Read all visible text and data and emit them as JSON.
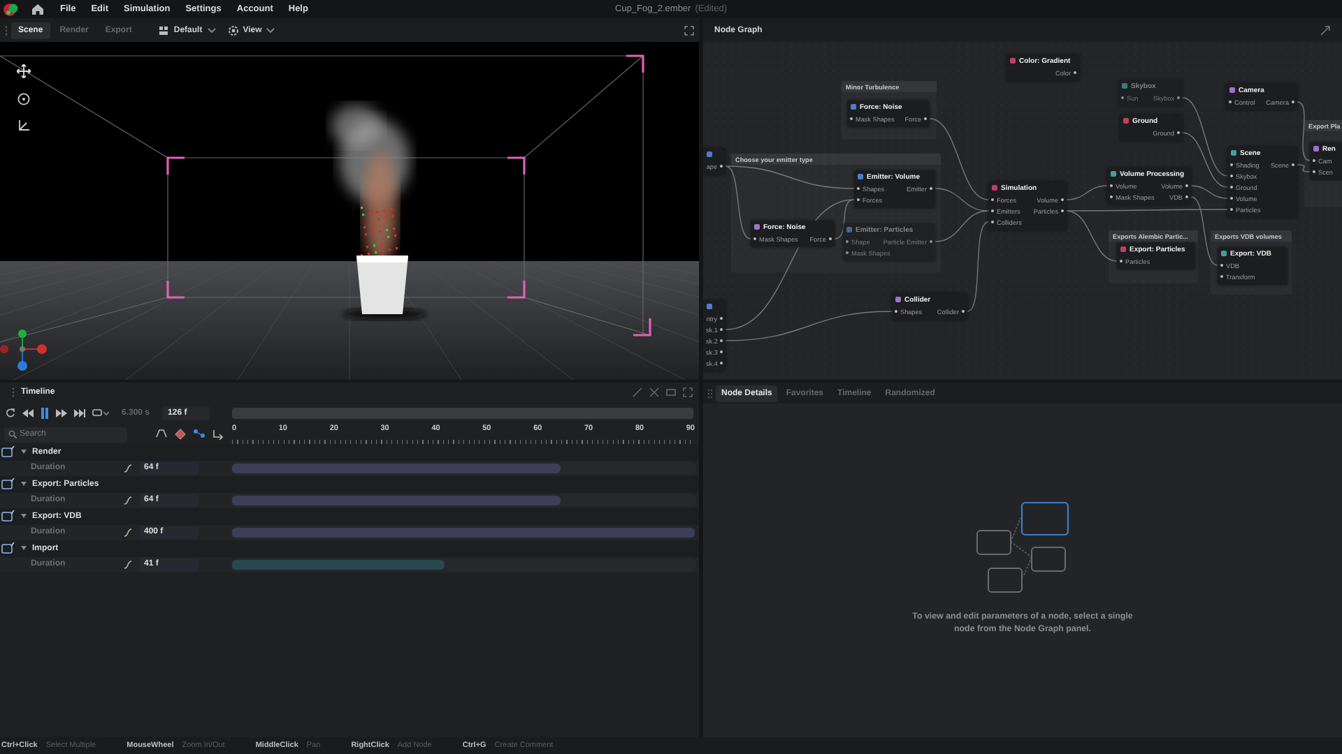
{
  "app": {
    "menu": [
      "File",
      "Edit",
      "Simulation",
      "Settings",
      "Account",
      "Help"
    ],
    "title": "Cup_Fog_2.ember",
    "status": "(Edited)"
  },
  "viewport_toolbar": {
    "tabs": [
      {
        "label": "Scene",
        "selected": true
      },
      {
        "label": "Render",
        "selected": false
      },
      {
        "label": "Export",
        "selected": false
      }
    ],
    "layout": "Default",
    "view": "View"
  },
  "node_graph": {
    "title": "Node Graph",
    "groups": [
      {
        "title": "Minor Turbulence"
      },
      {
        "title": "Export Pla"
      },
      {
        "title": "Choose your emitter type"
      },
      {
        "title": "Exports Alembic Partic..."
      },
      {
        "title": "Exports VDB volumes"
      }
    ],
    "nodes": [
      {
        "outputs": [
          "ape"
        ],
        "disabled": false
      },
      {
        "title": "Color: Gradient",
        "outputs": [
          "Color"
        ],
        "disabled": false
      },
      {
        "title": "Skybox",
        "inputs": [
          "Sun"
        ],
        "outputs": [
          "Skybox"
        ],
        "disabled": true
      },
      {
        "title": "Camera",
        "inputs": [
          "Control"
        ],
        "outputs": [
          "Camera"
        ],
        "disabled": false
      },
      {
        "title": "Force: Noise",
        "inputs": [
          "Mask Shapes"
        ],
        "outputs": [
          "Force"
        ],
        "disabled": false
      },
      {
        "title": "Ground",
        "outputs": [
          "Ground"
        ],
        "disabled": false
      },
      {
        "title": "Scene",
        "inputs": [
          "Shading",
          "Skybox",
          "Ground",
          "Volume",
          "Particles"
        ],
        "outputs": [
          "Scene"
        ],
        "disabled": false
      },
      {
        "title": "Ren",
        "inputs": [
          "Cam",
          "Scen"
        ],
        "disabled": false
      },
      {
        "title": "Emitter: Volume",
        "inputs": [
          "Shapes",
          "Forces"
        ],
        "outputs": [
          "Emitter"
        ],
        "disabled": false
      },
      {
        "title": "Simulation",
        "inputs": [
          "Forces",
          "Emitters",
          "Colliders"
        ],
        "outputs": [
          "Volume",
          "Particles"
        ],
        "disabled": false
      },
      {
        "title": "Volume Processing",
        "inputs": [
          "Volume",
          "Mask Shapes"
        ],
        "outputs": [
          "Volume",
          "VDB"
        ],
        "disabled": false
      },
      {
        "title": "Force: Noise",
        "inputs": [
          "Mask Shapes"
        ],
        "outputs": [
          "Force"
        ],
        "disabled": false
      },
      {
        "title": "Emitter: Particles",
        "inputs": [
          "Shape",
          "Mask Shapes"
        ],
        "outputs": [
          "Particle Emitter"
        ],
        "disabled": true
      },
      {
        "title": "Export: Particles",
        "inputs": [
          "Particles"
        ],
        "disabled": false
      },
      {
        "title": "Export: VDB",
        "inputs": [
          "VDB",
          "Transform"
        ],
        "disabled": false
      },
      {
        "title": "Collider",
        "inputs": [
          "Shapes"
        ],
        "outputs": [
          "Collider"
        ],
        "disabled": false
      },
      {
        "outputs": [
          "ntry",
          "sk.1",
          "sk.2",
          "sk.3",
          "sk.4"
        ],
        "disabled": false
      }
    ]
  },
  "timeline": {
    "title": "Timeline",
    "playing": true,
    "time": "6.300 s",
    "frame": "126 f",
    "search": {
      "placeholder": "Search"
    },
    "ruler": [
      "0",
      "10",
      "20",
      "30",
      "40",
      "50",
      "60",
      "70",
      "80",
      "90"
    ],
    "tracks": [
      {
        "name": "Render",
        "expanded": true,
        "param": "Duration",
        "value": "64 f",
        "level": 0.71,
        "color": "#3c3f55"
      },
      {
        "name": "Export: Particles",
        "expanded": true,
        "param": "Duration",
        "value": "64 f",
        "level": 0.71,
        "color": "#3c3f55"
      },
      {
        "name": "Export: VDB",
        "expanded": true,
        "param": "Duration",
        "value": "400 f",
        "level": 1,
        "color": "#3c3f55"
      },
      {
        "name": "Import",
        "expanded": true,
        "param": "Duration",
        "value": "41 f",
        "level": 0.46,
        "color": "#28474f"
      }
    ]
  },
  "details": {
    "tabs": [
      {
        "label": "Node Details",
        "selected": true
      },
      {
        "label": "Favorites",
        "selected": false
      },
      {
        "label": "Timeline",
        "selected": false
      },
      {
        "label": "Randomized",
        "selected": false
      }
    ],
    "message": "To view and edit parameters of a node, select a single node from the Node Graph panel."
  },
  "status_bar": [
    {
      "key": "Ctrl+Click",
      "action": "Select Multiple"
    },
    {
      "key": "MouseWheel",
      "action": "Zoom In/Out"
    },
    {
      "key": "MiddleClick",
      "action": "Pan"
    },
    {
      "key": "RightClick",
      "action": "Add Node"
    },
    {
      "key": "Ctrl+G",
      "action": "Create Comment"
    }
  ]
}
